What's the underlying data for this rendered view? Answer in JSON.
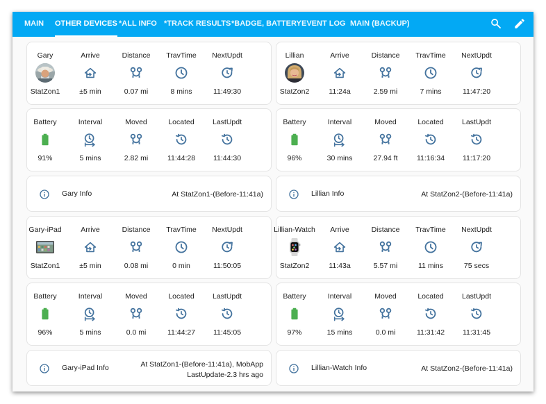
{
  "colors": {
    "accent": "#03a9f4",
    "icon": "#44739e",
    "battery": "#4caf50"
  },
  "tabs": [
    "MAIN",
    "OTHER DEVICES",
    "*ALL INFO",
    "*TRACK RESULTS",
    "*BADGE, BATTERY",
    "EVENT LOG",
    "MAIN (BACKUP)"
  ],
  "active_tab": "OTHER DEVICES",
  "toolbar_icons": [
    "search-icon",
    "pencil-icon"
  ],
  "labels": {
    "arrive": "Arrive",
    "distance": "Distance",
    "travtime": "TravTime",
    "nextupdt": "NextUpdt",
    "battery": "Battery",
    "interval": "Interval",
    "moved": "Moved",
    "located": "Located",
    "lastupdt": "LastUpdt"
  },
  "devices": [
    {
      "name": "Gary",
      "avatar": "person-avatar-man",
      "zone": "StatZon1",
      "arrive": "±5 min",
      "distance": "0.07 mi",
      "travtime": "8 mins",
      "nextupdt": "11:49:30",
      "battery": "91%",
      "interval": "5 mins",
      "moved": "2.82 mi",
      "located": "11:44:28",
      "lastupdt": "11:44:30",
      "info_name": "Gary Info",
      "info_status": "At StatZon1-(Before-11:41a)",
      "info_status2": ""
    },
    {
      "name": "Lillian",
      "avatar": "person-avatar-woman",
      "zone": "StatZon2",
      "arrive": "11:24a",
      "distance": "2.59 mi",
      "travtime": "7 mins",
      "nextupdt": "11:47:20",
      "battery": "96%",
      "interval": "30 mins",
      "moved": "27.94 ft",
      "located": "11:16:34",
      "lastupdt": "11:17:20",
      "info_name": "Lillian Info",
      "info_status": "At StatZon2-(Before-11:41a)",
      "info_status2": ""
    },
    {
      "name": "Gary-iPad",
      "avatar": "ipad-image",
      "zone": "StatZon1",
      "arrive": "±5 min",
      "distance": "0.08 mi",
      "travtime": "0 min",
      "nextupdt": "11:50:05",
      "battery": "96%",
      "interval": "5 mins",
      "moved": "0.0 mi",
      "located": "11:44:27",
      "lastupdt": "11:45:05",
      "info_name": "Gary-iPad Info",
      "info_status": "At StatZon1-(Before-11:41a), MobApp",
      "info_status2": "LastUpdate-2.3 hrs ago"
    },
    {
      "name": "Lillian-Watch",
      "avatar": "watch-image",
      "zone": "StatZon2",
      "arrive": "11:43a",
      "distance": "5.57 mi",
      "travtime": "11 mins",
      "nextupdt": "75 secs",
      "battery": "97%",
      "interval": "15 mins",
      "moved": "0.0 mi",
      "located": "11:31:42",
      "lastupdt": "11:31:45",
      "info_name": "Lillian-Watch Info",
      "info_status": "At StatZon2-(Before-11:41a)",
      "info_status2": ""
    }
  ]
}
